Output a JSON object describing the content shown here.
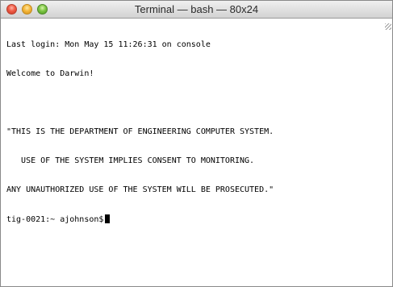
{
  "window": {
    "title": "Terminal — bash — 80x24"
  },
  "terminal": {
    "lines": [
      "Last login: Mon May 15 11:26:31 on console",
      "Welcome to Darwin!",
      "",
      "\"THIS IS THE DEPARTMENT OF ENGINEERING COMPUTER SYSTEM.",
      "   USE OF THE SYSTEM IMPLIES CONSENT TO MONITORING.",
      "ANY UNAUTHORIZED USE OF THE SYSTEM WILL BE PROSECUTED.\""
    ],
    "prompt": "tig-0021:~ ajohnson$"
  },
  "icons": {
    "close": "close-button",
    "minimize": "minimize-button",
    "zoom": "zoom-button",
    "resize": "resize-grip-icon"
  },
  "colors": {
    "close": "#ee5a44",
    "minimize": "#f4b63a",
    "zoom": "#7cc443",
    "text": "#000000",
    "background": "#ffffff"
  }
}
